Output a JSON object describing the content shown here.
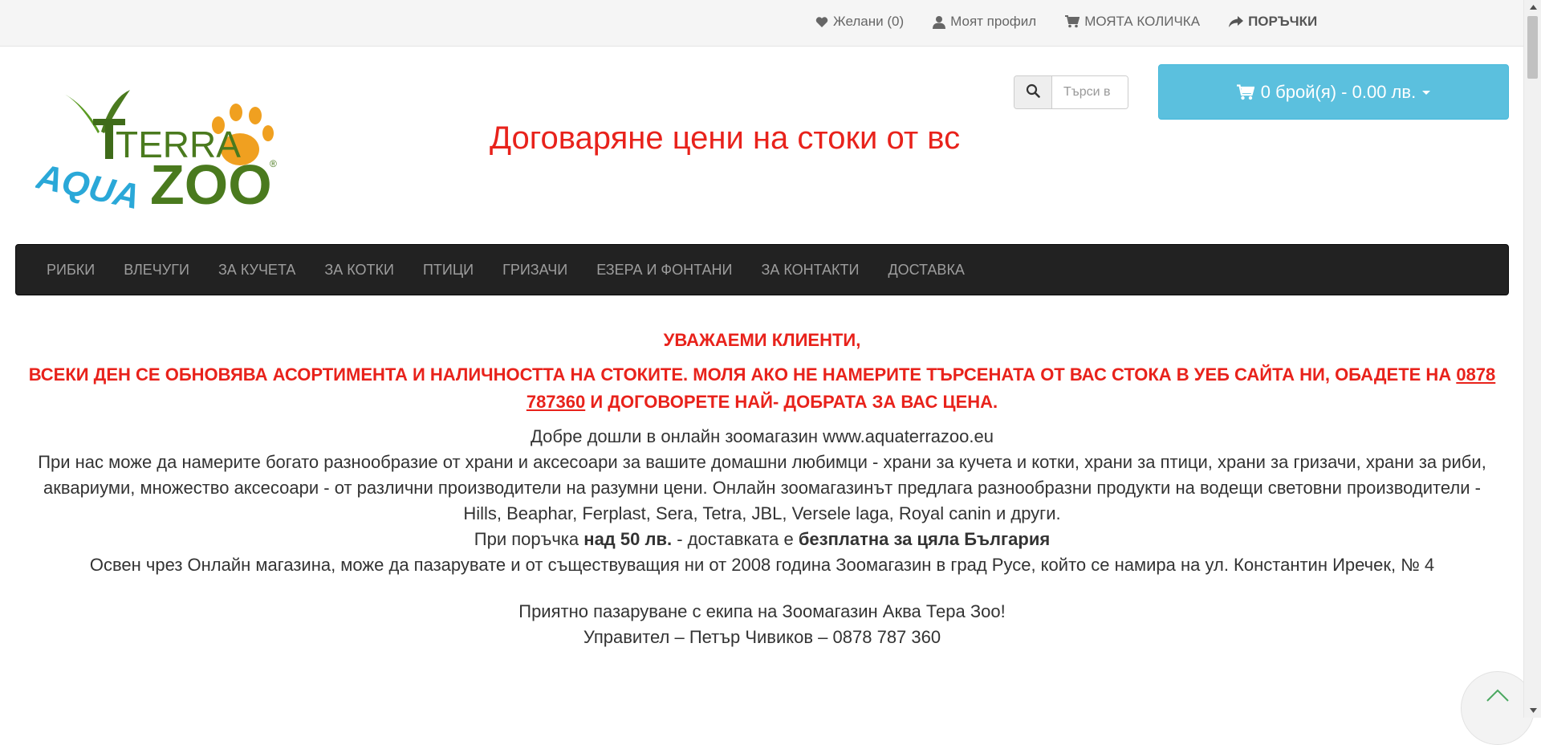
{
  "topbar": {
    "wishlist": "Желани (0)",
    "profile": "Моят профил",
    "cart": "МОЯТА КОЛИЧКА",
    "orders": "ПОРЪЧКИ"
  },
  "logo": {
    "text_terra": "TERRA",
    "text_aqua": "AQUA",
    "text_zoo": "ZOO",
    "registered": "®"
  },
  "marquee": {
    "text": "Договаряне цени на стоки от вс"
  },
  "search": {
    "placeholder": "Търси в"
  },
  "cart": {
    "label": "0 брой(я) - 0.00 лв."
  },
  "nav": {
    "items": [
      {
        "label": "РИБКИ"
      },
      {
        "label": "ВЛЕЧУГИ"
      },
      {
        "label": "ЗА КУЧЕТА"
      },
      {
        "label": "ЗА КОТКИ"
      },
      {
        "label": "ПТИЦИ"
      },
      {
        "label": "ГРИЗАЧИ"
      },
      {
        "label": "ЕЗЕРА И ФОНТАНИ"
      },
      {
        "label": "ЗА КОНТАКТИ"
      },
      {
        "label": "ДОСТАВКА"
      }
    ]
  },
  "notice": {
    "title": "УВАЖАЕМИ КЛИЕНТИ,",
    "body_before": "ВСЕКИ ДЕН СЕ ОБНОВЯВА АСОРТИМЕНТА И НАЛИЧНОСТТА НА СТОКИТЕ. МОЛЯ АКО НЕ НАМЕРИТЕ ТЪРСЕНАТА ОТ ВАС СТОКА В УЕБ САЙТА НИ, ОБАДЕТЕ НА ",
    "phone": "0878 787360",
    "body_after": " И ДОГОВОРЕТЕ НАЙ- ДОБРАТА ЗА ВАС ЦЕНА."
  },
  "welcome": {
    "line1": "Добре дошли в онлайн зоомагазин www.aquaterrazoo.eu",
    "line2": "При нас може да намерите богато разнообразие от храни и аксесоари за вашите домашни любимци - храни за кучета и котки, храни за птици, храни за гризачи, храни за риби, аквариуми, множество аксесоари - от различни производители на разумни цени. Онлайн зоомагазинът предлага разнообразни продукти на водещи световни производители - Hills, Beaphar, Ferplast, Sera, Tetra, JBL, Versele laga, Royal canin и други.",
    "delivery_pre": "При поръчка ",
    "delivery_amount": "над 50 лв.",
    "delivery_mid": " - доставката е ",
    "delivery_free": "безплатна за цяла България",
    "line4": "Освен чрез Онлайн магазина, може да пазарувате и от съществуващия ни от 2008 година Зоомагазин в град Русе, който се намира на ул. Константин Иречек, № 4",
    "line5": "Приятно пазаруване с екипа на Зоомагазин Аква Тера Зоо!",
    "line6": "Управител – Петър Чивиков – 0878 787 360"
  },
  "icons": {
    "wishlist": "heart-icon",
    "profile": "user-icon",
    "cart": "shopping-cart-icon",
    "orders": "share-arrow-icon",
    "search": "search-icon",
    "to_top": "chevron-up-icon"
  },
  "colors": {
    "accent_red": "#e8221b",
    "cart_blue": "#5bc0de",
    "nav_bg": "#222222",
    "logo_green": "#4a7a1e",
    "logo_orange": "#f0a020",
    "logo_blue": "#2aa8d8"
  }
}
